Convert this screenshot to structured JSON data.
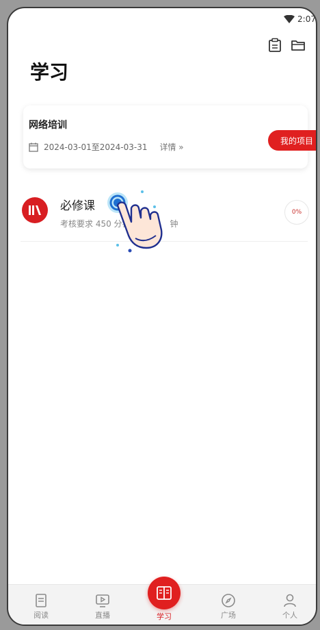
{
  "status_bar": {
    "time": "2:07"
  },
  "page": {
    "title": "学习"
  },
  "project": {
    "title": "网络培训",
    "date_range": "2024-03-01至2024-03-31",
    "detail_link": "详情 »",
    "my_project_button": "我的项目"
  },
  "course": {
    "title": "必修课",
    "requirement": "考核要求 450 分钟",
    "requirement_suffix": "钟",
    "progress": "0%"
  },
  "tabs": [
    {
      "label": "阅读",
      "icon": "book-icon"
    },
    {
      "label": "直播",
      "icon": "live-icon"
    },
    {
      "label": "学习",
      "icon": "study-icon",
      "active": true
    },
    {
      "label": "广场",
      "icon": "compass-icon"
    },
    {
      "label": "个人",
      "icon": "person-icon"
    }
  ],
  "colors": {
    "accent": "#e02020",
    "progress_text": "#c8302c"
  }
}
